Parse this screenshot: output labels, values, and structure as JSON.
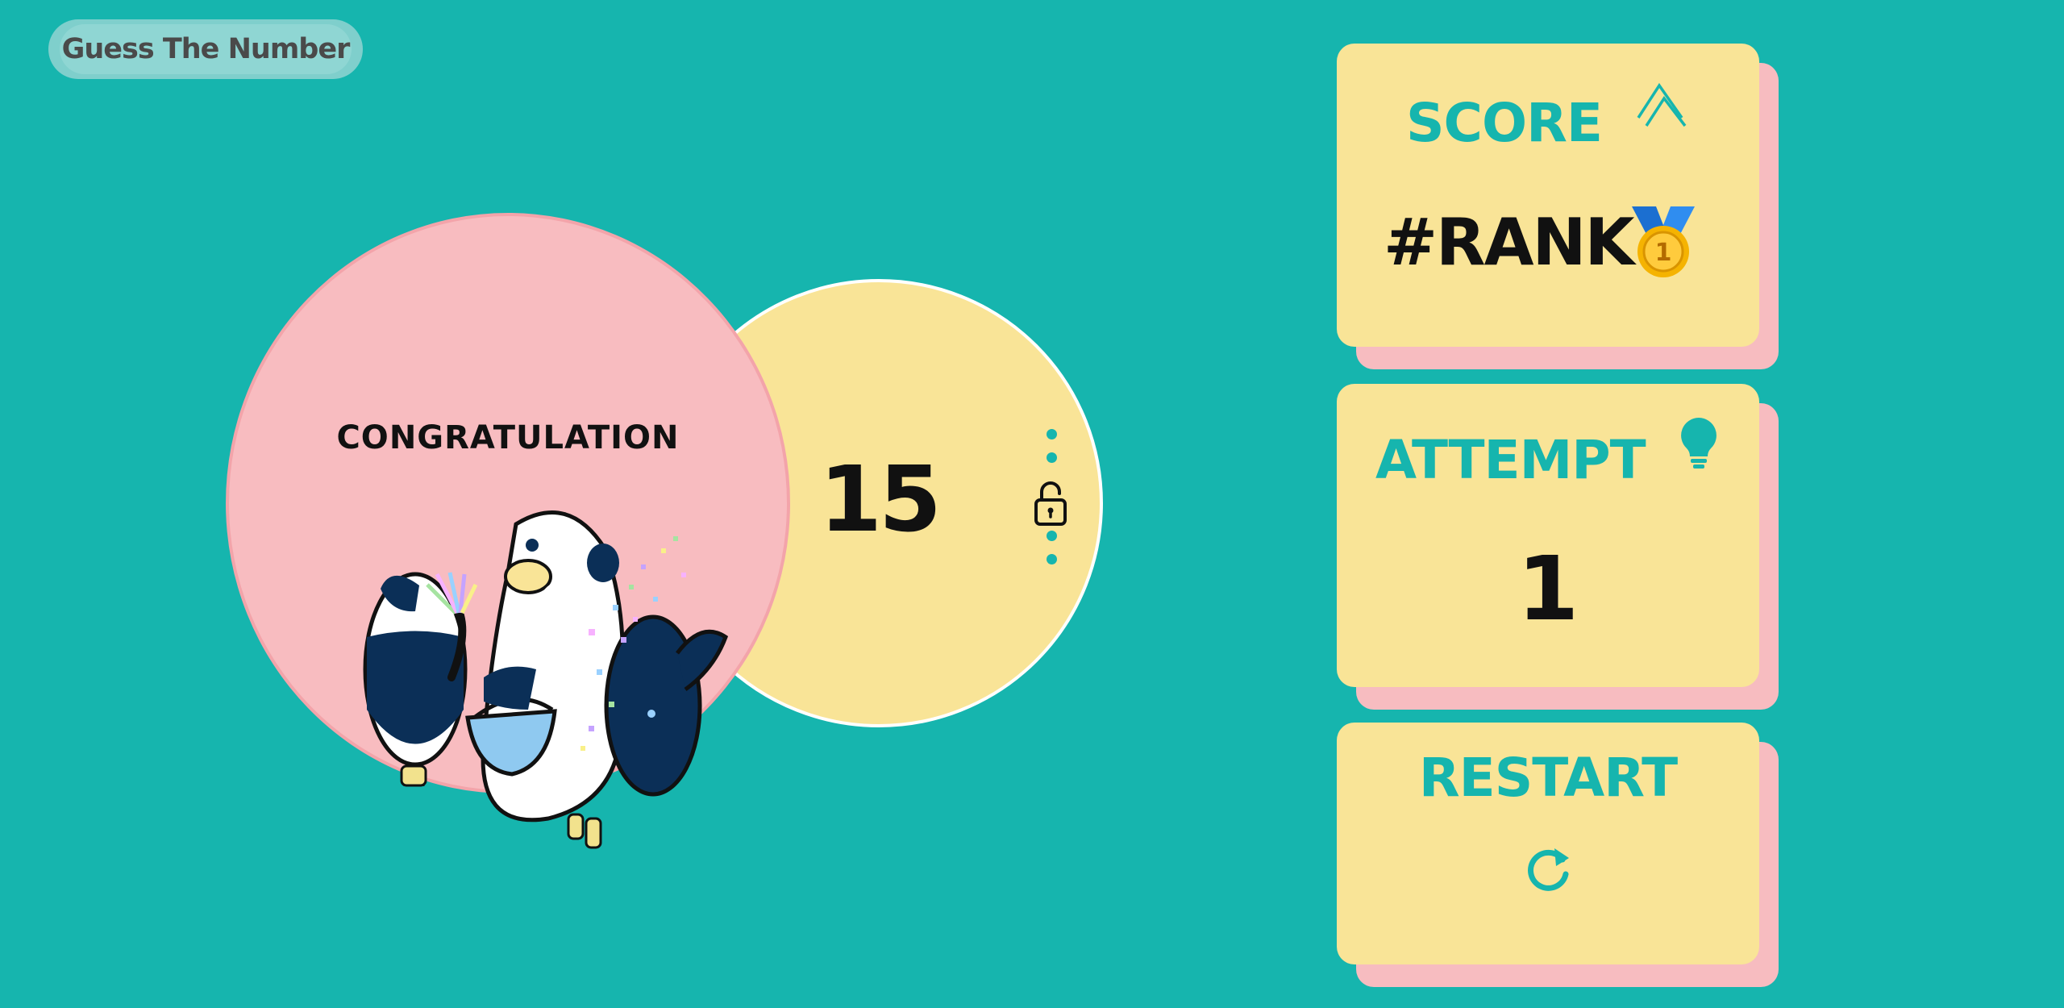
{
  "app": {
    "title": "Guess The Number"
  },
  "result": {
    "message": "CONGRATULATION",
    "secret_number": "15"
  },
  "score_card": {
    "label": "SCORE",
    "rank_text": "#RANK",
    "medal_number": "1"
  },
  "attempt_card": {
    "label": "ATTEMPT",
    "value": "1"
  },
  "restart_card": {
    "label": "RESTART"
  },
  "colors": {
    "background": "#16b5ae",
    "card": "#f9e497",
    "card_shadow": "#f7bcc0",
    "accent": "#16b5ae",
    "pink_circle": "#f8bcc0",
    "yellow_circle": "#f9e497"
  },
  "icons": {
    "score": "chevron-up-icon",
    "attempt": "lightbulb-icon",
    "restart": "refresh-icon",
    "lock": "unlock-icon",
    "medal": "gold-medal-icon"
  }
}
